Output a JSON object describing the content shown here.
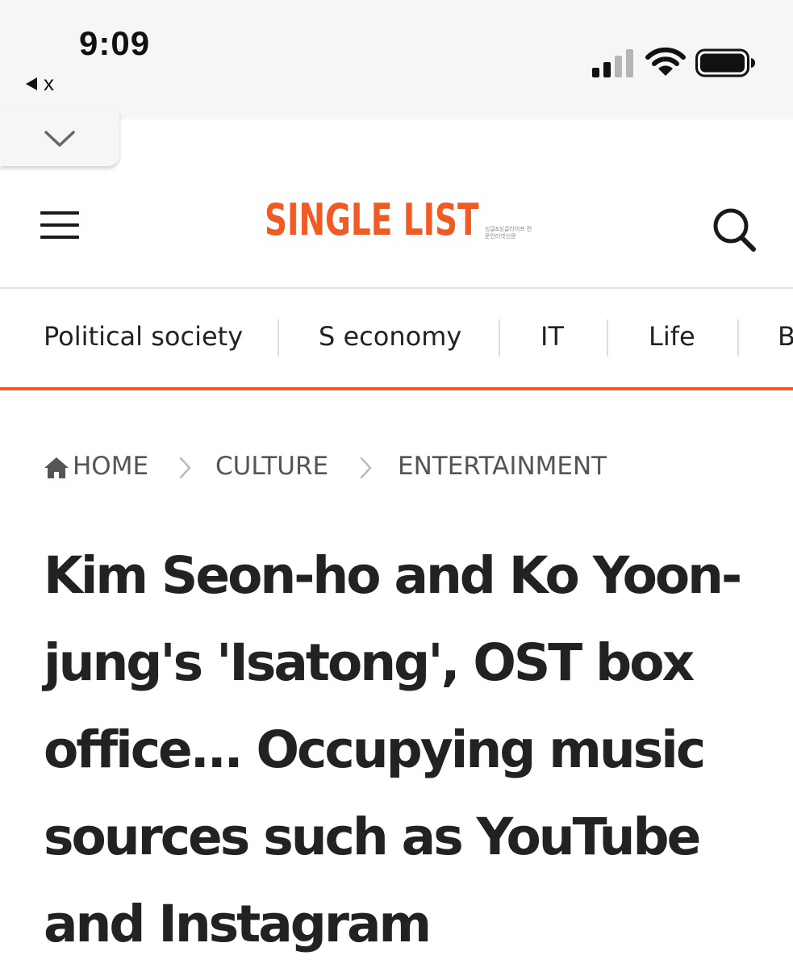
{
  "status_bar": {
    "time": "9:09",
    "back_app_label": "x"
  },
  "header": {
    "logo_text": "SINGLE LIST",
    "logo_subtext": "싱글&싱글라이프 전문인터넷신문"
  },
  "nav": {
    "items": [
      {
        "label": "Political society"
      },
      {
        "label": "S economy"
      },
      {
        "label": "IT"
      },
      {
        "label": "Life"
      },
      {
        "label": "B"
      }
    ]
  },
  "breadcrumb": {
    "home": "HOME",
    "section": "CULTURE",
    "subsection": "ENTERTAINMENT"
  },
  "article": {
    "headline": "Kim Seon-ho and Ko Yoon-jung's 'Isatong', OST box office... Occupying music sources such as YouTube and Instagram"
  },
  "colors": {
    "brand": "#f15a22",
    "text": "#222222",
    "status_bar_bg": "#f6f6f6"
  },
  "icons": {
    "menu": "hamburger-icon",
    "search": "search-icon",
    "home": "home-icon",
    "collapse": "chevron-down-icon",
    "breadcrumb_separator": "chevron-right-icon"
  }
}
